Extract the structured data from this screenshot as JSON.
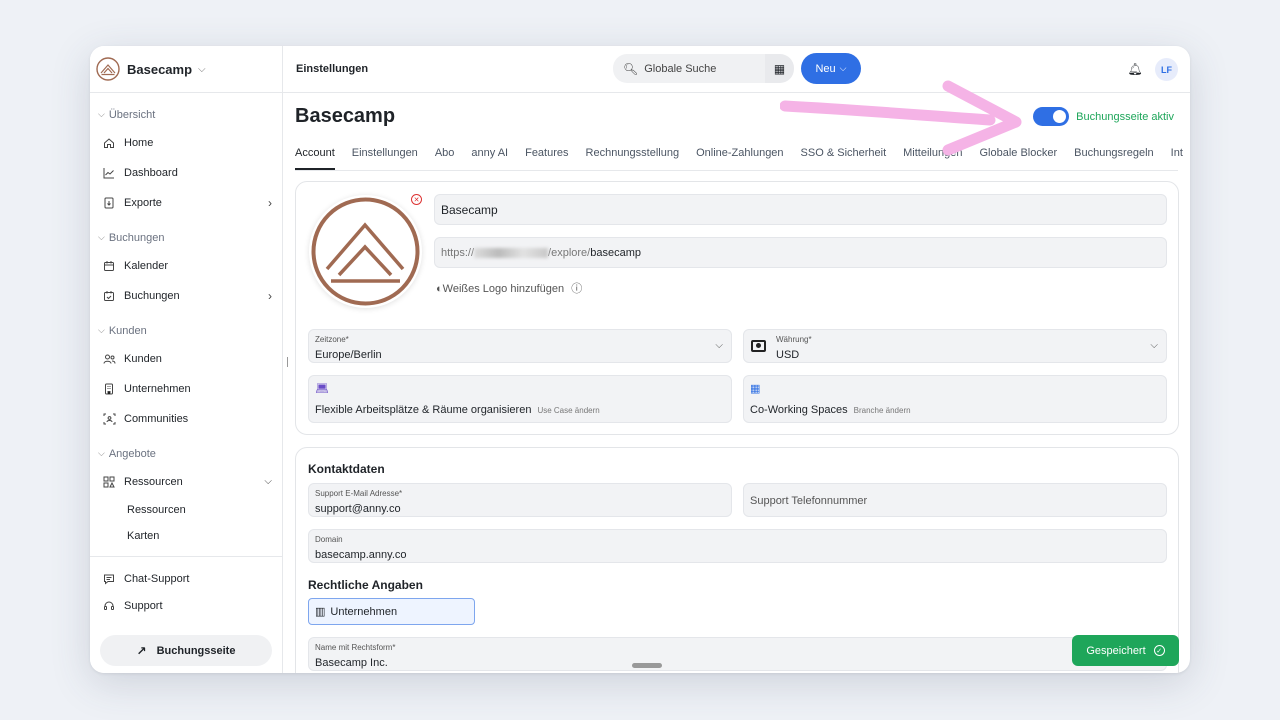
{
  "sidebar": {
    "brand": "Basecamp",
    "sections": [
      {
        "label": "Übersicht"
      },
      {
        "label": "Buchungen"
      },
      {
        "label": "Kunden"
      },
      {
        "label": "Angebote"
      }
    ],
    "items": {
      "home": "Home",
      "dashboard": "Dashboard",
      "exporte": "Exporte",
      "kalender": "Kalender",
      "buchungen": "Buchungen",
      "kunden": "Kunden",
      "unternehmen": "Unternehmen",
      "communities": "Communities",
      "ressourcen": "Ressourcen",
      "ressourcen_sub": "Ressourcen",
      "karten": "Karten",
      "chat_support": "Chat-Support",
      "support": "Support"
    },
    "booking_button": "Buchungsseite"
  },
  "topbar": {
    "title": "Einstellungen",
    "search_placeholder": "Globale Suche",
    "new_button": "Neu",
    "avatar_initials": "LF"
  },
  "page": {
    "title": "Basecamp",
    "toggle_label": "Buchungsseite aktiv",
    "toggle_on": true,
    "tabs": [
      "Account",
      "Einstellungen",
      "Abo",
      "anny AI",
      "Features",
      "Rechnungsstellung",
      "Online-Zahlungen",
      "SSO & Sicherheit",
      "Mitteilungen",
      "Globale Blocker",
      "Buchungsregeln",
      "Int"
    ]
  },
  "account": {
    "name": "Basecamp",
    "url_prefix": "https://",
    "url_mid": "/explore/",
    "url_slug": "basecamp",
    "white_logo": "Weißes Logo hinzufügen",
    "timezone_label": "Zeitzone*",
    "timezone_value": "Europe/Berlin",
    "currency_label": "Währung*",
    "currency_value": "USD",
    "use_case": "Flexible Arbeitsplätze & Räume organisieren",
    "use_case_change": "Use Case ändern",
    "branch": "Co-Working Spaces",
    "branch_change": "Branche ändern"
  },
  "contact": {
    "heading": "Kontaktdaten",
    "email_label": "Support E-Mail Adresse*",
    "email_value": "support@anny.co",
    "phone_placeholder": "Support Telefonnummer",
    "domain_label": "Domain",
    "domain_value": "basecamp.anny.co",
    "legal_heading": "Rechtliche Angaben",
    "company_chip": "Unternehmen",
    "legal_name_label": "Name mit Rechtsform*",
    "legal_name_value": "Basecamp Inc."
  },
  "status": {
    "saved": "Gespeichert"
  },
  "colors": {
    "accent": "#2f6fe4",
    "success": "#1ea65a",
    "brand_logo": "#a06a52",
    "annotation_arrow": "#f5b3e6"
  }
}
